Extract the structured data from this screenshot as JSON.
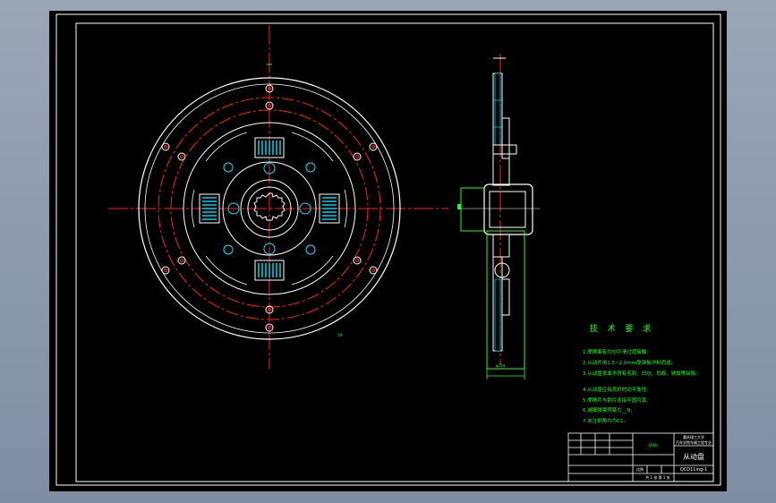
{
  "drawing": {
    "tech_title": "技 术 要 求",
    "requirements": [
      "1.摩擦面有均匀平滑过渡接触;",
      "2.从动片用1.5~2.0mm厚钢板冲制而成;",
      "3.从动盘表面不得有毛刺、凹坑、划痕、锈蚀等缺陷;",
      "4.从动盘应有良好的动平衡性;",
      "5.摩擦片与钢片连接牢固可靠;",
      "6.减振弹簧预紧力__N;",
      "7.未注倒角均为C1。"
    ],
    "note_mark": "3#",
    "dim_label": "φ254",
    "title_block": {
      "part_name": "从动盘",
      "school_line1": "重庆理工大学",
      "school_line2": "汽车学院车辆工程专业",
      "drawing_no": "QCD11ing-1",
      "scale_label": "比例",
      "sheet": "共 1 张  第 1 张",
      "material": "65Mn"
    }
  },
  "colors": {
    "background": "#000000",
    "outline": "#ffffff",
    "centerline": "#ff2020",
    "spring": "#00e5ff",
    "annotation": "#20ff20"
  }
}
